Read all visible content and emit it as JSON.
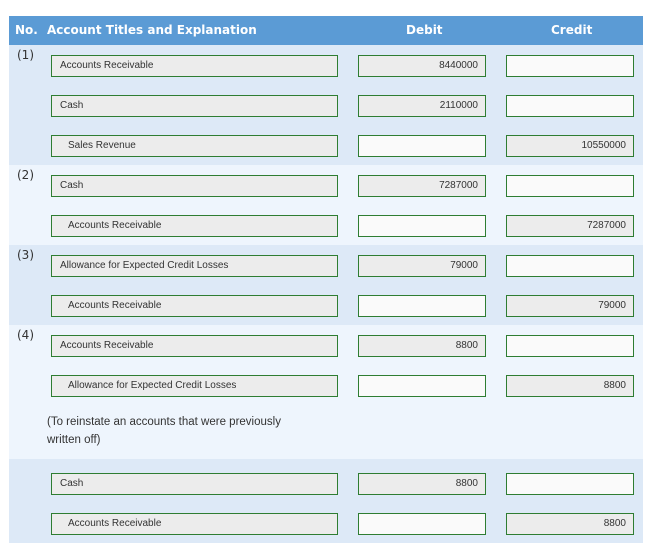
{
  "header": {
    "no": "No.",
    "account": "Account Titles and Explanation",
    "debit": "Debit",
    "credit": "Credit"
  },
  "entries": [
    {
      "no": "(1)",
      "lines": [
        {
          "account": "Accounts Receivable",
          "debit": "8440000",
          "credit": ""
        },
        {
          "account": "Cash",
          "debit": "2110000",
          "credit": ""
        },
        {
          "account": "Sales Revenue",
          "debit": "",
          "credit": "10550000"
        }
      ]
    },
    {
      "no": "(2)",
      "lines": [
        {
          "account": "Cash",
          "debit": "7287000",
          "credit": ""
        },
        {
          "account": "Accounts Receivable",
          "debit": "",
          "credit": "7287000"
        }
      ]
    },
    {
      "no": "(3)",
      "lines": [
        {
          "account": "Allowance for Expected Credit Losses",
          "debit": "79000",
          "credit": ""
        },
        {
          "account": "Accounts Receivable",
          "debit": "",
          "credit": "79000"
        }
      ]
    },
    {
      "no": "(4)",
      "lines": [
        {
          "account": "Accounts Receivable",
          "debit": "8800",
          "credit": ""
        },
        {
          "account": "Allowance for Expected Credit Losses",
          "debit": "",
          "credit": "8800"
        }
      ],
      "note": "(To reinstate an accounts that were previously written off)"
    },
    {
      "no": "",
      "lines": [
        {
          "account": "Cash",
          "debit": "8800",
          "credit": ""
        },
        {
          "account": "Accounts Receivable",
          "debit": "",
          "credit": "8800"
        }
      ]
    }
  ],
  "colors": {
    "header_bg": "#5b9bd5",
    "row_dark": "#dde9f7",
    "row_light": "#eef5fd",
    "field_border": "#2e7d32"
  }
}
